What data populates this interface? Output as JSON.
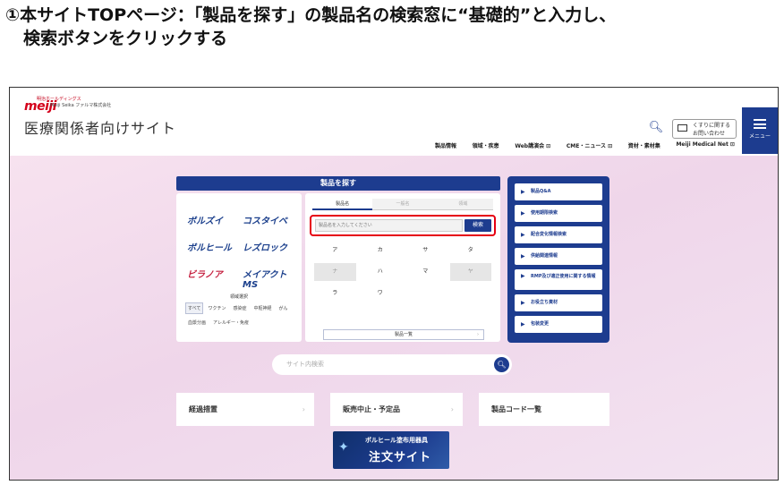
{
  "instruction": {
    "line1": "①本サイトTOPページ：「製品を探す」の製品名の検索窓に“基礎的”と入力し、",
    "line2": "検索ボタンをクリックする"
  },
  "header": {
    "brand_small": "明治ホールディングス",
    "logo": "meiji",
    "company": "Meiji Seika ファルマ株式会社",
    "site_title": "医療関係者向けサイト",
    "contact_label": "くすりに関する お問い合わせ",
    "menu_label": "メニュー",
    "nav": [
      "製品情報",
      "領域・疾患",
      "Web講演会 ⊡",
      "CME・ニュース ⊡",
      "資材・素材集",
      "Meiji Medical Net ⊡"
    ]
  },
  "product_search": {
    "title": "製品を探す",
    "brands": [
      "ボルズイ",
      "コスタイベ",
      "ボルヒール",
      "レズロック",
      "ビラノア",
      "メイアクトMS"
    ],
    "field_title": "領域選択",
    "chips": [
      "すべて",
      "ワクチン",
      "感染症",
      "中枢神経",
      "がん",
      "血漿分画",
      "アレルギー・免疫"
    ],
    "tabs": [
      "製品名",
      "一般名",
      "領域"
    ],
    "search_placeholder": "製品名を入力してください",
    "search_button": "検索",
    "kana": [
      "ア",
      "カ",
      "サ",
      "タ",
      "ナ",
      "ハ",
      "マ",
      "ヤ",
      "ラ",
      "ワ"
    ],
    "list_button": "製品一覧"
  },
  "quick_links": [
    "製品Q&A",
    "使用期限検索",
    "配合変化情報検索",
    "供給関連情報",
    "RMP及び適正使用に関する情報",
    "お役立ち資材",
    "包装変更"
  ],
  "site_search": {
    "placeholder": "サイト内検索"
  },
  "cards": [
    "経過措置",
    "販売中止・予定品",
    "製品コード一覧"
  ],
  "banner": {
    "top": "ボルヒール塗布用器具",
    "main": "注文サイト"
  }
}
